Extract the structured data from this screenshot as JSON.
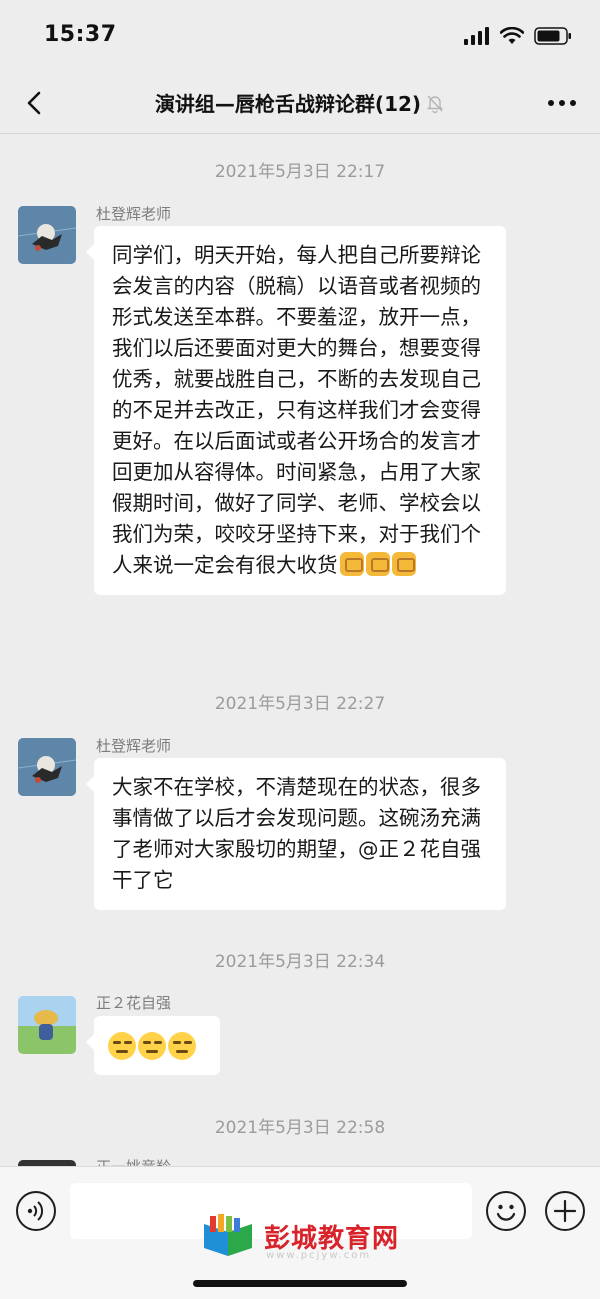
{
  "status_bar": {
    "time": "15:37"
  },
  "nav": {
    "title": "演讲组—唇枪舌战辩论群(12)",
    "back_icon": "chevron-left-icon",
    "mute_icon": "bell-muted-icon",
    "more_icon": "more-dots-icon"
  },
  "messages": [
    {
      "timestamp": "2021年5月3日 22:17",
      "sender": "杜登辉老师",
      "text": "同学们，明天开始，每人把自己所要辩论会发言的内容（脱稿）以语音或者视频的形式发送至本群。不要羞涩，放开一点，我们以后还要面对更大的舞台，想要变得优秀，就要战胜自己，不断的去发现自己的不足并去改正，只有这样我们才会变得更好。在以后面试或者公开场合的发言才回更加从容得体。时间紧急，占用了大家假期时间，做好了同学、老师、学校会以我们为荣，咬咬牙坚持下来，对于我们个人来说一定会有很大收货"
    },
    {
      "timestamp": "2021年5月3日 22:27",
      "sender": "杜登辉老师",
      "text": "大家不在学校，不清楚现在的状态，很多事情做了以后才会发现问题。这碗汤充满了老师对大家殷切的期望，@正２花自强 干了它"
    },
    {
      "timestamp": "2021年5月3日 22:34",
      "sender": "正２花自强"
    },
    {
      "timestamp": "2021年5月3日 22:58",
      "sender": "正一姚竞羚"
    }
  ],
  "watermark": {
    "text": "彭城教育网",
    "sub": "www.pcjyw.com"
  },
  "colors": {
    "background": "#ededed",
    "bubble": "#ffffff",
    "timestamp": "#9b9b9b",
    "watermark": "#d8232a"
  }
}
